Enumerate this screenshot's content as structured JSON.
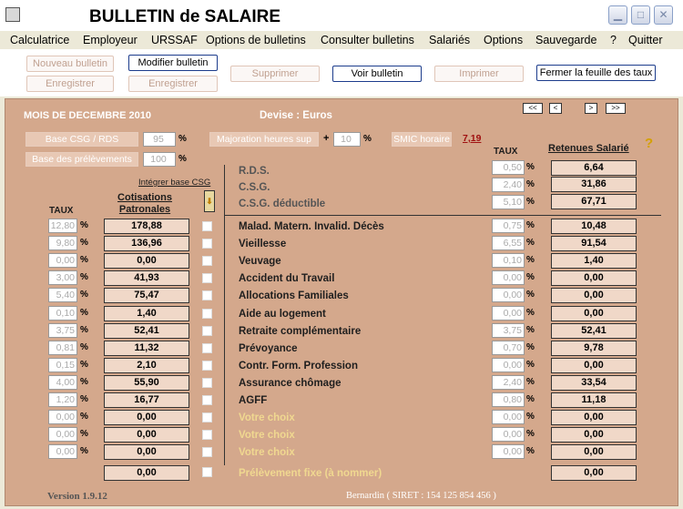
{
  "app": {
    "title": "BULLETIN de SALAIRE"
  },
  "menu": [
    "Calculatrice",
    "Employeur",
    "URSSAF",
    "Options de bulletins",
    "Consulter bulletins",
    "Salariés",
    "Options",
    "Sauvegarde",
    "?",
    "Quitter"
  ],
  "toolbar": {
    "nouveau": "Nouveau bulletin",
    "modifier": "Modifier bulletin",
    "enregistrer1": "Enregistrer",
    "enregistrer2": "Enregistrer",
    "supprimer": "Supprimer",
    "voir": "Voir bulletin",
    "imprimer": "Imprimer",
    "fermer": "Fermer la feuille des taux"
  },
  "header": {
    "month": "MOIS DE DECEMBRE 2010",
    "devise": "Devise : Euros",
    "nav": [
      "<<",
      "<",
      ">",
      ">>"
    ]
  },
  "top": {
    "base_csg_label": "Base CSG / RDS",
    "base_csg_value": "95",
    "base_prel_label": "Base des prélèvements",
    "base_prel_value": "100",
    "majoration_label": "Majoration heures sup",
    "majoration_value": "10",
    "plus": "+",
    "pct": "%",
    "smic_label": "SMIC horaire",
    "smic_value": "7,19",
    "integrer": "Intégrer base CSG",
    "taux_left": "TAUX",
    "taux_right": "TAUX",
    "cot_patronales": "Cotisations Patronales",
    "retenues": "Retenues Salarié",
    "help": "?"
  },
  "csg_rows": [
    {
      "label": "R.D.S.",
      "rate": "0,50",
      "amount": "6,64"
    },
    {
      "label": "C.S.G.",
      "rate": "2,40",
      "amount": "31,86"
    },
    {
      "label": "C.S.G. déductible",
      "rate": "5,10",
      "amount": "67,71"
    }
  ],
  "rows": [
    {
      "label": "Malad. Matern. Invalid. Décès",
      "p_rate": "12,80",
      "p_amount": "178,88",
      "s_rate": "0,75",
      "s_amount": "10,48",
      "choice": false
    },
    {
      "label": "Vieillesse",
      "p_rate": "9,80",
      "p_amount": "136,96",
      "s_rate": "6,55",
      "s_amount": "91,54",
      "choice": false
    },
    {
      "label": "Veuvage",
      "p_rate": "0,00",
      "p_amount": "0,00",
      "s_rate": "0,10",
      "s_amount": "1,40",
      "choice": false
    },
    {
      "label": "Accident du Travail",
      "p_rate": "3,00",
      "p_amount": "41,93",
      "s_rate": "0,00",
      "s_amount": "0,00",
      "choice": false
    },
    {
      "label": "Allocations Familiales",
      "p_rate": "5,40",
      "p_amount": "75,47",
      "s_rate": "0,00",
      "s_amount": "0,00",
      "choice": false
    },
    {
      "label": "Aide au logement",
      "p_rate": "0,10",
      "p_amount": "1,40",
      "s_rate": "0,00",
      "s_amount": "0,00",
      "choice": false
    },
    {
      "label": "Retraite complémentaire",
      "p_rate": "3,75",
      "p_amount": "52,41",
      "s_rate": "3,75",
      "s_amount": "52,41",
      "choice": false
    },
    {
      "label": "Prévoyance",
      "p_rate": "0,81",
      "p_amount": "11,32",
      "s_rate": "0,70",
      "s_amount": "9,78",
      "choice": false
    },
    {
      "label": "Contr. Form. Profession",
      "p_rate": "0,15",
      "p_amount": "2,10",
      "s_rate": "0,00",
      "s_amount": "0,00",
      "choice": false
    },
    {
      "label": "Assurance chômage",
      "p_rate": "4,00",
      "p_amount": "55,90",
      "s_rate": "2,40",
      "s_amount": "33,54",
      "choice": false
    },
    {
      "label": "AGFF",
      "p_rate": "1,20",
      "p_amount": "16,77",
      "s_rate": "0,80",
      "s_amount": "11,18",
      "choice": false
    },
    {
      "label": "Votre choix",
      "p_rate": "0,00",
      "p_amount": "0,00",
      "s_rate": "0,00",
      "s_amount": "0,00",
      "choice": true
    },
    {
      "label": "Votre choix",
      "p_rate": "0,00",
      "p_amount": "0,00",
      "s_rate": "0,00",
      "s_amount": "0,00",
      "choice": true
    },
    {
      "label": "Votre choix",
      "p_rate": "0,00",
      "p_amount": "0,00",
      "s_rate": "0,00",
      "s_amount": "0,00",
      "choice": true
    }
  ],
  "fixed_row": {
    "label": "Prélèvement fixe (à nommer)",
    "p_amount": "0,00",
    "s_amount": "0,00"
  },
  "footer": {
    "version": "Version 1.9.12",
    "company": "Bernardin  ( SIRET : 154 125 854 456 )"
  }
}
